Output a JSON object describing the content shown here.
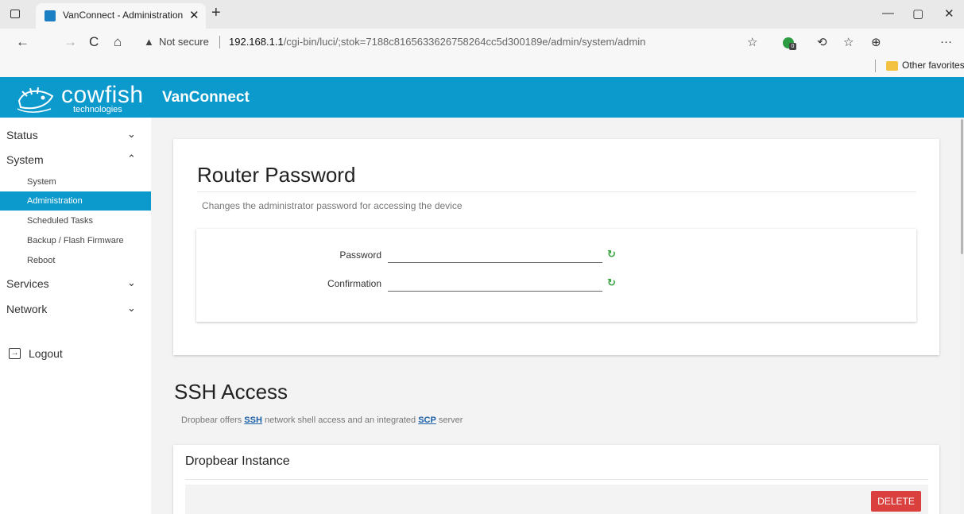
{
  "browser": {
    "tab_title": "VanConnect - Administration - LuCI",
    "tab_close": "✕",
    "new_tab": "+",
    "win_min": "—",
    "win_restore": "▢",
    "win_close": "✕",
    "back": "←",
    "forward": "→",
    "reload": "C",
    "home": "⌂",
    "not_secure": "Not secure",
    "url_host": "192.168.1.1",
    "url_path": "/cgi-bin/luci/;stok=7188c8165633626758264cc5d300189e/admin/system/admin",
    "ext_badge": "0",
    "favorites_folder": "Other favorites",
    "menu_dots": "···"
  },
  "app": {
    "logo_word": "cowfish",
    "logo_sub": "technologies",
    "title": "VanConnect",
    "accent_color": "#0c99cc"
  },
  "sidebar": {
    "items": [
      {
        "label": "Status",
        "chevron": "⌄"
      },
      {
        "label": "System",
        "chevron": "⌃"
      },
      {
        "label": "Services",
        "chevron": "⌄"
      },
      {
        "label": "Network",
        "chevron": "⌄"
      }
    ],
    "system_sub": [
      {
        "label": "System"
      },
      {
        "label": "Administration"
      },
      {
        "label": "Scheduled Tasks"
      },
      {
        "label": "Backup / Flash Firmware"
      },
      {
        "label": "Reboot"
      }
    ],
    "logout": "Logout"
  },
  "router_password": {
    "heading": "Router Password",
    "description": "Changes the administrator password for accessing the device",
    "password_label": "Password",
    "password_value": "",
    "confirmation_label": "Confirmation",
    "confirmation_value": "",
    "generate_icon": "↻"
  },
  "ssh": {
    "heading": "SSH Access",
    "desc_pre": "Dropbear offers ",
    "desc_ssh": "SSH",
    "desc_mid": " network shell access and an integrated ",
    "desc_scp": "SCP",
    "desc_post": " server",
    "instance_heading": "Dropbear Instance",
    "delete_label": "DELETE",
    "delete_color": "#d9403e"
  }
}
